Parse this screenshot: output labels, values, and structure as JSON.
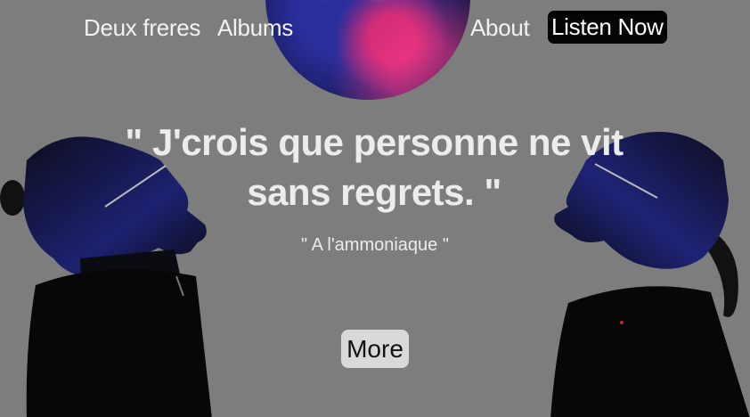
{
  "nav": {
    "brand": "Deux freres",
    "albums": "Albums",
    "about": "About",
    "listen_now": "Listen Now"
  },
  "hero": {
    "quote_line1": "\" J'crois que personne ne vit",
    "quote_line2": "sans regrets. \"",
    "source": "\" A l'ammoniaque \"",
    "more_label": "More"
  },
  "colors": {
    "background": "#7d7d7d",
    "text": "#ececec",
    "listen_button_bg": "#050505",
    "more_button_bg": "#d9d9d9"
  }
}
